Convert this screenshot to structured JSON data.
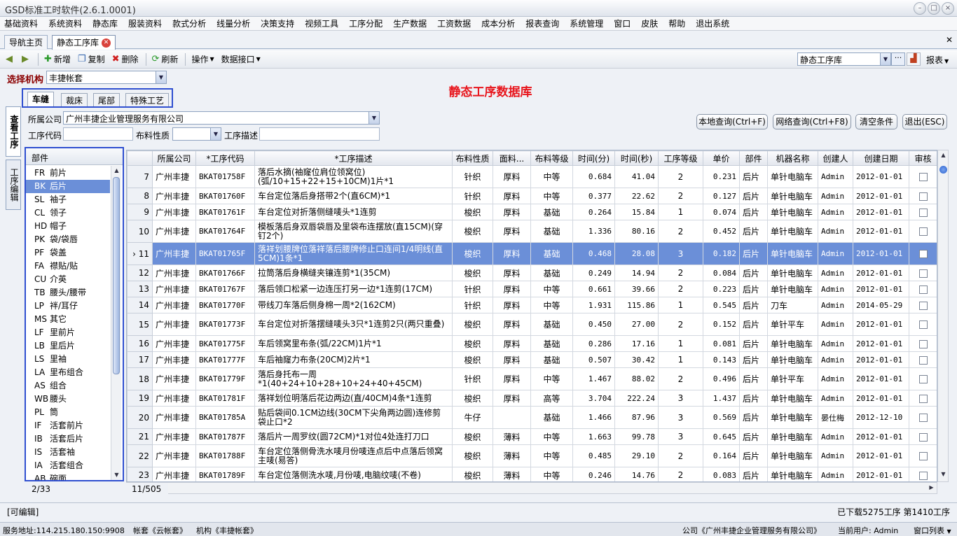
{
  "window": {
    "title": "GSD标准工时软件(2.6.1.0001)"
  },
  "menu": [
    "基础资料",
    "系统资料",
    "静态库",
    "服装资料",
    "款式分析",
    "线量分析",
    "决策支持",
    "视频工具",
    "工序分配",
    "生产数据",
    "工资数据",
    "成本分析",
    "报表查询",
    "系统管理",
    "窗口",
    "皮肤",
    "帮助",
    "退出系统"
  ],
  "doc_tabs": {
    "home": "导航主页",
    "active": "静态工序库"
  },
  "toolbar": {
    "add": "新增",
    "copy": "复制",
    "delete": "删除",
    "refresh": "刷新",
    "ops": "操作",
    "data_iface": "数据接口",
    "lib_select": "静态工序库",
    "report": "报表"
  },
  "org": {
    "label": "选择机构",
    "value": "丰捷帐套"
  },
  "page_title": "静态工序数据库",
  "inner_tabs": [
    "车缝",
    "裁床",
    "尾部",
    "特殊工艺"
  ],
  "side_tabs": {
    "view": "查看工序",
    "edit": "工序编辑"
  },
  "filters": {
    "company_label": "所属公司",
    "company_value": "广州丰捷企业管理服务有限公司",
    "code_label": "工序代码",
    "fabric_label": "布料性质",
    "desc_label": "工序描述"
  },
  "query_buttons": {
    "local": "本地查询(Ctrl+F)",
    "network": "网络查询(Ctrl+F8)",
    "clear": "清空条件",
    "exit": "退出(ESC)"
  },
  "parts": {
    "header": "部件",
    "items": [
      {
        "code": "FR",
        "name": "前片"
      },
      {
        "code": "BK",
        "name": "后片"
      },
      {
        "code": "SL",
        "name": "袖子"
      },
      {
        "code": "CL",
        "name": "领子"
      },
      {
        "code": "HD",
        "name": "帽子"
      },
      {
        "code": "PK",
        "name": "袋/袋唇"
      },
      {
        "code": "PF",
        "name": "袋盖"
      },
      {
        "code": "FA",
        "name": "襟贴/贴"
      },
      {
        "code": "CU",
        "name": "介英"
      },
      {
        "code": "TB",
        "name": "腰头/腰带"
      },
      {
        "code": "LP",
        "name": "袢/耳仔"
      },
      {
        "code": "MS",
        "name": "其它"
      },
      {
        "code": "LF",
        "name": "里前片"
      },
      {
        "code": "LB",
        "name": "里后片"
      },
      {
        "code": "LS",
        "name": "里袖"
      },
      {
        "code": "LA",
        "name": "里布组合"
      },
      {
        "code": "AS",
        "name": "组合"
      },
      {
        "code": "WB",
        "name": "腰头"
      },
      {
        "code": "PL",
        "name": "筒"
      },
      {
        "code": "IF",
        "name": "活套前片"
      },
      {
        "code": "IB",
        "name": "活套后片"
      },
      {
        "code": "IS",
        "name": "活套袖"
      },
      {
        "code": "IA",
        "name": "活套组合"
      },
      {
        "code": "AB",
        "name": "碗面"
      }
    ],
    "footer": "2/33"
  },
  "grid": {
    "columns": [
      "所属公司",
      "*工序代码",
      "*工序描述",
      "布料性质",
      "面料...",
      "布料等级",
      "时间(分)",
      "时间(秒)",
      "工序等级",
      "单价",
      "部件",
      "机器名称",
      "创建人",
      "创建日期",
      "审核"
    ],
    "rows": [
      {
        "n": "7",
        "co": "广州丰捷",
        "code": "BKAT01758F",
        "desc": "落后水摘(袖窿位肩位领窝位)(弧/10+15+22+15+10CM)1片*1",
        "fab": "针织",
        "mat": "厚料",
        "lvl": "中等",
        "min": "0.684",
        "sec": "41.04",
        "g": "2",
        "price": "0.231",
        "part": "后片",
        "mach": "单针电脑车",
        "by": "Admin",
        "date": "2012-01-01"
      },
      {
        "n": "8",
        "co": "广州丰捷",
        "code": "BKAT01760F",
        "desc": "车台定位落后身搭带2个(直6CM)*1",
        "fab": "针织",
        "mat": "厚料",
        "lvl": "中等",
        "min": "0.377",
        "sec": "22.62",
        "g": "2",
        "price": "0.127",
        "part": "后片",
        "mach": "单针电脑车",
        "by": "Admin",
        "date": "2012-01-01"
      },
      {
        "n": "9",
        "co": "广州丰捷",
        "code": "BKAT01761F",
        "desc": "车台定位对折落侧缝唛头*1连剪",
        "fab": "梭织",
        "mat": "厚料",
        "lvl": "基础",
        "min": "0.264",
        "sec": "15.84",
        "g": "1",
        "price": "0.074",
        "part": "后片",
        "mach": "单针电脑车",
        "by": "Admin",
        "date": "2012-01-01"
      },
      {
        "n": "10",
        "co": "广州丰捷",
        "code": "BKAT01764F",
        "desc": "模板落后身双唇袋唇及里袋布连摆放(直15CM)(穿钉2个)",
        "fab": "梭织",
        "mat": "厚料",
        "lvl": "基础",
        "min": "1.336",
        "sec": "80.16",
        "g": "2",
        "price": "0.452",
        "part": "后片",
        "mach": "单针电脑车",
        "by": "Admin",
        "date": "2012-01-01"
      },
      {
        "n": "11",
        "co": "广州丰捷",
        "code": "BKAT01765F",
        "desc": "落祥划腰牌位落祥落后腰牌修止口连间1/4明线(直5CM)1条*1",
        "fab": "梭织",
        "mat": "厚料",
        "lvl": "基础",
        "min": "0.468",
        "sec": "28.08",
        "g": "3",
        "price": "0.182",
        "part": "后片",
        "mach": "单针电脑车",
        "by": "Admin",
        "date": "2012-01-01",
        "sel": true
      },
      {
        "n": "12",
        "co": "广州丰捷",
        "code": "BKAT01766F",
        "desc": "拉筒落后身横缝夹镶连剪*1(35CM)",
        "fab": "梭织",
        "mat": "厚料",
        "lvl": "基础",
        "min": "0.249",
        "sec": "14.94",
        "g": "2",
        "price": "0.084",
        "part": "后片",
        "mach": "单针电脑车",
        "by": "Admin",
        "date": "2012-01-01"
      },
      {
        "n": "13",
        "co": "广州丰捷",
        "code": "BKAT01767F",
        "desc": "落后领口松紧一边连压打另一边*1连剪(17CM)",
        "fab": "针织",
        "mat": "厚料",
        "lvl": "中等",
        "min": "0.661",
        "sec": "39.66",
        "g": "2",
        "price": "0.223",
        "part": "后片",
        "mach": "单针电脑车",
        "by": "Admin",
        "date": "2012-01-01"
      },
      {
        "n": "14",
        "co": "广州丰捷",
        "code": "BKAT01770F",
        "desc": "带线刀车落后侧身棉一周*2(162CM)",
        "fab": "针织",
        "mat": "厚料",
        "lvl": "中等",
        "min": "1.931",
        "sec": "115.86",
        "g": "1",
        "price": "0.545",
        "part": "后片",
        "mach": "刀车",
        "by": "Admin",
        "date": "2014-05-29"
      },
      {
        "n": "15",
        "co": "广州丰捷",
        "code": "BKAT01773F",
        "desc": "车台定位对折落摆缝唛头3只*1连剪2只(两只重叠)",
        "fab": "梭织",
        "mat": "厚料",
        "lvl": "基础",
        "min": "0.450",
        "sec": "27.00",
        "g": "2",
        "price": "0.152",
        "part": "后片",
        "mach": "单针平车",
        "by": "Admin",
        "date": "2012-01-01"
      },
      {
        "n": "16",
        "co": "广州丰捷",
        "code": "BKAT01775F",
        "desc": "车后领窝里布条(弧/22CM)1片*1",
        "fab": "梭织",
        "mat": "厚料",
        "lvl": "基础",
        "min": "0.286",
        "sec": "17.16",
        "g": "1",
        "price": "0.081",
        "part": "后片",
        "mach": "单针电脑车",
        "by": "Admin",
        "date": "2012-01-01"
      },
      {
        "n": "17",
        "co": "广州丰捷",
        "code": "BKAT01777F",
        "desc": "车后袖窿力布条(20CM)2片*1",
        "fab": "梭织",
        "mat": "厚料",
        "lvl": "基础",
        "min": "0.507",
        "sec": "30.42",
        "g": "1",
        "price": "0.143",
        "part": "后片",
        "mach": "单针电脑车",
        "by": "Admin",
        "date": "2012-01-01"
      },
      {
        "n": "18",
        "co": "广州丰捷",
        "code": "BKAT01779F",
        "desc": "落后身托布一周*1(40+24+10+28+10+24+40+45CM)",
        "fab": "针织",
        "mat": "厚料",
        "lvl": "中等",
        "min": "1.467",
        "sec": "88.02",
        "g": "2",
        "price": "0.496",
        "part": "后片",
        "mach": "单针平车",
        "by": "Admin",
        "date": "2012-01-01"
      },
      {
        "n": "19",
        "co": "广州丰捷",
        "code": "BKAT01781F",
        "desc": "落祥划位明落后花边两边(直/40CM)4条*1连剪",
        "fab": "梭织",
        "mat": "厚料",
        "lvl": "高等",
        "min": "3.704",
        "sec": "222.24",
        "g": "3",
        "price": "1.437",
        "part": "后片",
        "mach": "单针电脑车",
        "by": "Admin",
        "date": "2012-01-01"
      },
      {
        "n": "20",
        "co": "广州丰捷",
        "code": "BKAT01785A",
        "desc": "贴后袋间0.1CM边线(30CM下尖角两边圆)连修剪袋止口*2",
        "fab": "牛仔",
        "mat": "",
        "lvl": "基础",
        "min": "1.466",
        "sec": "87.96",
        "g": "3",
        "price": "0.569",
        "part": "后片",
        "mach": "单针电脑车",
        "by": "晏仕梅",
        "date": "2012-12-10"
      },
      {
        "n": "21",
        "co": "广州丰捷",
        "code": "BKAT01787F",
        "desc": "落后片一周罗纹(圆72CM)*1对位4处连打刀口",
        "fab": "梭织",
        "mat": "薄料",
        "lvl": "中等",
        "min": "1.663",
        "sec": "99.78",
        "g": "3",
        "price": "0.645",
        "part": "后片",
        "mach": "单针电脑车",
        "by": "Admin",
        "date": "2012-01-01"
      },
      {
        "n": "22",
        "co": "广州丰捷",
        "code": "BKAT01788F",
        "desc": "车台定位落侧骨洗水唛月份唛连点后中点落后领窝主唛(易答)",
        "fab": "梭织",
        "mat": "薄料",
        "lvl": "中等",
        "min": "0.485",
        "sec": "29.10",
        "g": "2",
        "price": "0.164",
        "part": "后片",
        "mach": "单针电脑车",
        "by": "Admin",
        "date": "2012-01-01"
      },
      {
        "n": "23",
        "co": "广州丰捷",
        "code": "BKAT01789F",
        "desc": "车台定位落侧洗水唛,月份唛,电脑纹唛(不卷)",
        "fab": "梭织",
        "mat": "薄料",
        "lvl": "中等",
        "min": "0.246",
        "sec": "14.76",
        "g": "2",
        "price": "0.083",
        "part": "后片",
        "mach": "单针电脑车",
        "by": "Admin",
        "date": "2012-01-01"
      }
    ],
    "footer": "11/505"
  },
  "status": {
    "left": "[可编辑]",
    "right": "已下载5275工序 第1410工序"
  },
  "bottom": {
    "server": "服务地址:114.215.180.150:9908",
    "account": "帐套《云帐套》",
    "org": "机构《丰捷帐套》",
    "company": "公司《广州丰捷企业管理服务有限公司》",
    "user": "当前用户: Admin",
    "winlist": "窗口列表"
  },
  "colors": {
    "accent": "#2f4fd0",
    "selected_row": "#6b8fd8",
    "page_title": "#e8161d"
  }
}
